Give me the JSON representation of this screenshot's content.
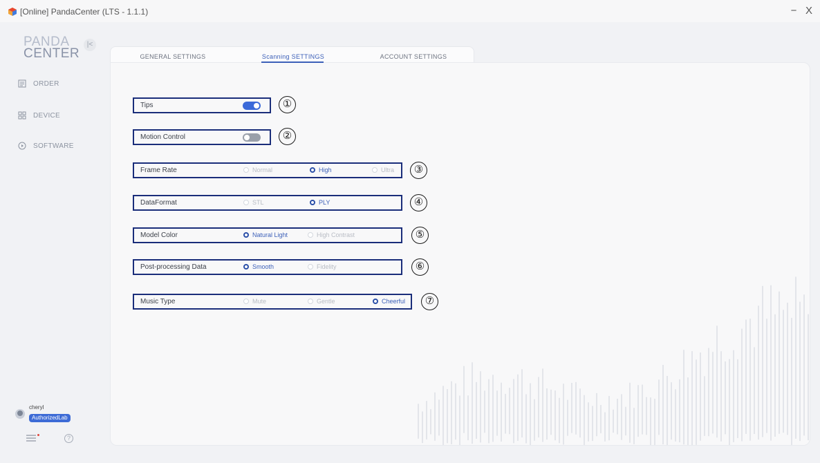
{
  "window": {
    "title": "[Online] PandaCenter (LTS - 1.1.1)",
    "minimize_glyph": "−",
    "close_glyph": "X"
  },
  "sidebar": {
    "logo_line1": "PANDA",
    "logo_line2": "CENTER",
    "collapse_glyph": "|<",
    "items": [
      {
        "label": "ORDER",
        "icon": "order-icon"
      },
      {
        "label": "DEVICE",
        "icon": "device-icon"
      },
      {
        "label": "SOFTWARE",
        "icon": "software-icon"
      }
    ],
    "user": {
      "name": "cheryl",
      "role": "AuthorizedLab"
    },
    "help_glyph": "?"
  },
  "tabs": [
    {
      "label": "GENERAL SETTINGS",
      "active": false
    },
    {
      "label": "Scanning SETTINGS",
      "active": true
    },
    {
      "label": "ACCOUNT SETTINGS",
      "active": false
    }
  ],
  "settings": {
    "tips": {
      "label": "Tips",
      "value": true,
      "marker": "①"
    },
    "motion_control": {
      "label": "Motion Control",
      "value": false,
      "marker": "②"
    },
    "frame_rate": {
      "label": "Frame Rate",
      "options": [
        "Normal",
        "High",
        "Ultra"
      ],
      "selected": "High",
      "marker": "③"
    },
    "data_format": {
      "label": "DataFormat",
      "options": [
        "STL",
        "PLY"
      ],
      "selected": "PLY",
      "marker": "④"
    },
    "model_color": {
      "label": "Model Color",
      "options": [
        "Natural Light",
        "High Contrast"
      ],
      "selected": "Natural Light",
      "marker": "⑤"
    },
    "post_processing": {
      "label": "Post-processing Data",
      "options": [
        "Smooth",
        "Fidelity"
      ],
      "selected": "Smooth",
      "marker": "⑥"
    },
    "music_type": {
      "label": "Music Type",
      "options": [
        "Mute",
        "Gentle",
        "Cheerful"
      ],
      "selected": "Cheerful",
      "marker": "⑦"
    }
  },
  "colors": {
    "accent": "#3b5fb8",
    "toggle_on": "#3b6ad9",
    "annotation_border": "#1a2d7a",
    "notification_dot": "#e0473c"
  }
}
